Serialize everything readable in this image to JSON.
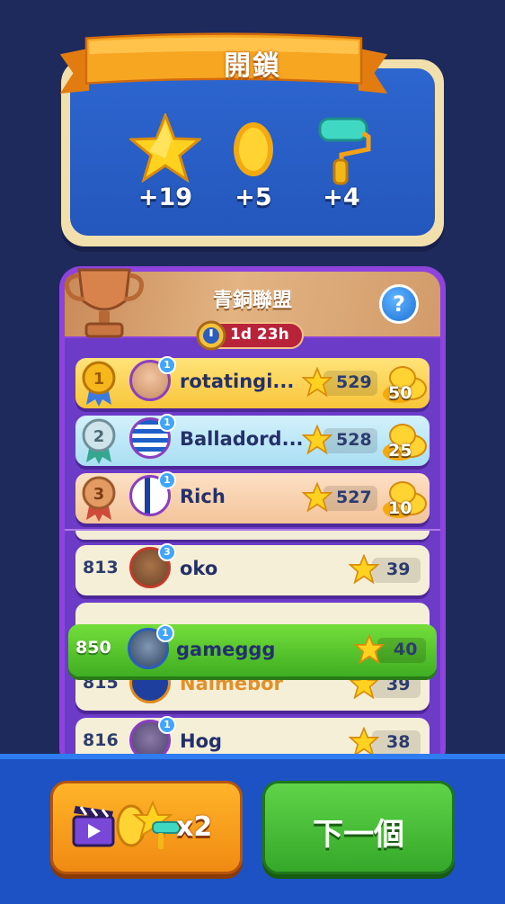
{
  "unlock": {
    "title": "開鎖",
    "rewards": [
      {
        "icon": "star-icon",
        "value": "+19"
      },
      {
        "icon": "coin-icon",
        "value": "+5"
      },
      {
        "icon": "paint-roller-icon",
        "value": "+4"
      }
    ]
  },
  "league": {
    "title": "青銅聯盟",
    "timer": "1d 23h",
    "help_label": "?",
    "top_rows": [
      {
        "rank": "1",
        "name": "rotatingi...",
        "level": "1",
        "score": "529",
        "coins": "50"
      },
      {
        "rank": "2",
        "name": "Balladord...",
        "level": "1",
        "score": "528",
        "coins": "25"
      },
      {
        "rank": "3",
        "name": "Rich",
        "level": "1",
        "score": "527",
        "coins": "10"
      }
    ],
    "rows": [
      {
        "rank": "813",
        "name": "oko",
        "level": "3",
        "score": "39"
      },
      {
        "rank": "815",
        "name": "Nalmebor",
        "level": "",
        "score": "39"
      },
      {
        "rank": "816",
        "name": "Hog",
        "level": "1",
        "score": "38"
      }
    ],
    "player_row": {
      "rank": "850",
      "name": "gameggg",
      "level": "1",
      "score": "40"
    }
  },
  "bottom": {
    "double_label": "x2",
    "next_label": "下一個"
  },
  "colors": {
    "accent_orange": "#f08a12",
    "accent_green": "#35a82a",
    "panel_blue": "#2457bd",
    "league_purple": "#8e43dc"
  }
}
